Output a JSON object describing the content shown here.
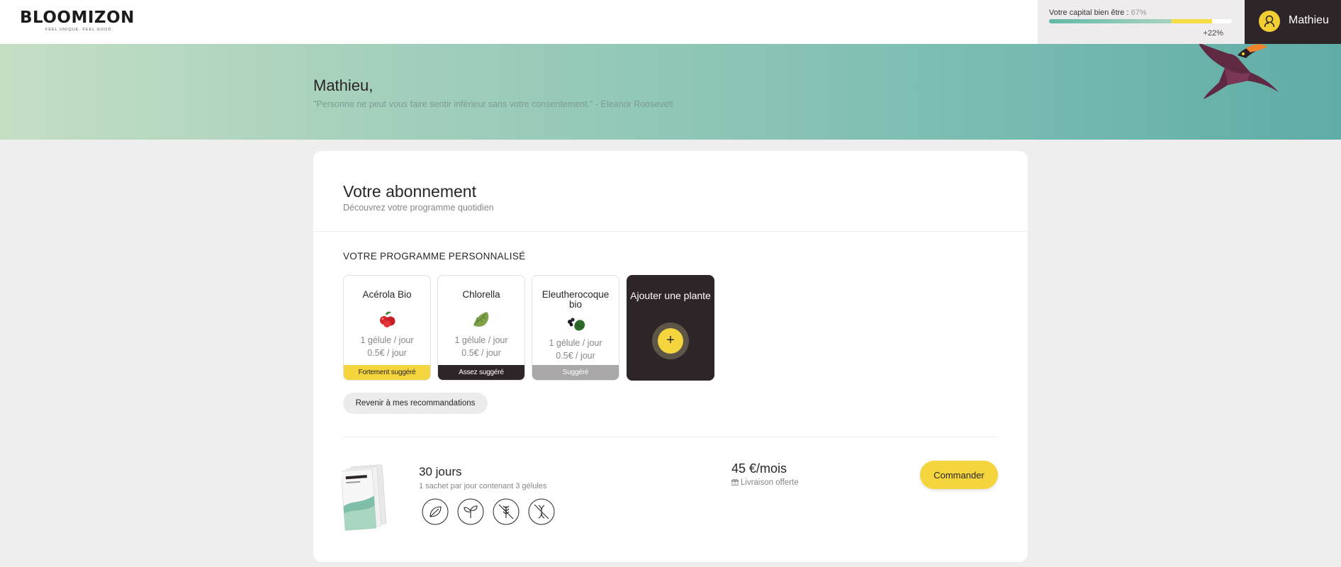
{
  "header": {
    "logo": "BLOOMIZON",
    "logo_tagline": "FEEL UNIQUE. FEEL GOOD.",
    "wellbeing_label": "Votre capital bien être :",
    "wellbeing_percent_label": "67%",
    "wellbeing_percent": 67,
    "wellbeing_gain_label": "+22%",
    "wellbeing_gain": 22,
    "user_name": "Mathieu"
  },
  "hero": {
    "greeting": "Mathieu,",
    "quote": "\"Personne ne peut vous faire sentir inférieur sans votre consentement.\" - Eleanor Roosevelt"
  },
  "subscription": {
    "title": "Votre abonnement",
    "subtitle": "Découvrez votre programme quotidien",
    "program_title": "VOTRE PROGRAMME PERSONNALISÉ",
    "plants": [
      {
        "name": "Acérola Bio",
        "dose": "1 gélule / jour",
        "price": "0.5€ / jour",
        "tag": "Fortement suggéré",
        "icon": "acerola-icon"
      },
      {
        "name": "Chlorella",
        "dose": "1 gélule / jour",
        "price": "0.5€ / jour",
        "tag": "Assez suggéré",
        "icon": "chlorella-icon"
      },
      {
        "name": "Eleutherocoque bio",
        "dose": "1 gélule / jour",
        "price": "0.5€ / jour",
        "tag": "Suggéré",
        "icon": "eleutherococcus-icon"
      }
    ],
    "add_plant_label": "Ajouter une plante",
    "add_plant_symbol": "+",
    "back_button": "Revenir à mes recommandations",
    "offer": {
      "sachet_brand": "BLOOMIZON",
      "days": "30 jours",
      "description": "1 sachet par jour contenant 3 gélules",
      "badges": [
        {
          "top": "ORIGINE",
          "bottom": "NATURELLE"
        },
        {
          "top": "PRODUIT",
          "bottom": "VEGAN"
        },
        {
          "top": "SANS",
          "bottom": "GLUTEN"
        },
        {
          "top": "SANS",
          "bottom": "OGM"
        }
      ],
      "price": "45 €/mois",
      "shipping": "Livraison offerte",
      "order_button": "Commander"
    }
  },
  "colors": {
    "accent_yellow": "#f5d53d",
    "dark": "#2d2527",
    "teal": "#5fada7"
  }
}
